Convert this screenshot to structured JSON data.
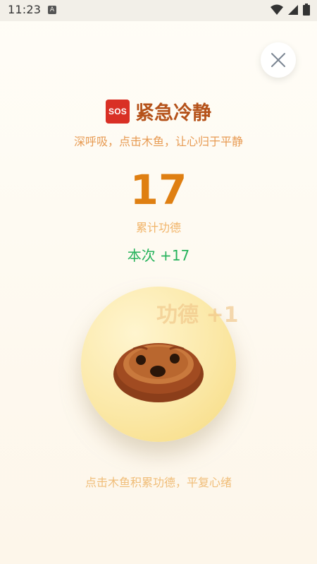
{
  "status_bar": {
    "time": "11:23",
    "icons": [
      "a-icon",
      "wifi-icon",
      "signal-icon",
      "battery-icon"
    ]
  },
  "header": {
    "badge": "SOS",
    "title": "紧急冷静",
    "subtitle": "深呼吸，点击木鱼，让心归于平静"
  },
  "stats": {
    "total": "17",
    "total_label": "累计功德",
    "session": "本次 +17"
  },
  "fish": {
    "float_text": "功德 +1"
  },
  "footer": {
    "hint": "点击木鱼积累功德，平复心绪"
  },
  "colors": {
    "title": "#b5521a",
    "counter": "#df7f12",
    "session": "#27b35c",
    "sos": "#d93025"
  }
}
